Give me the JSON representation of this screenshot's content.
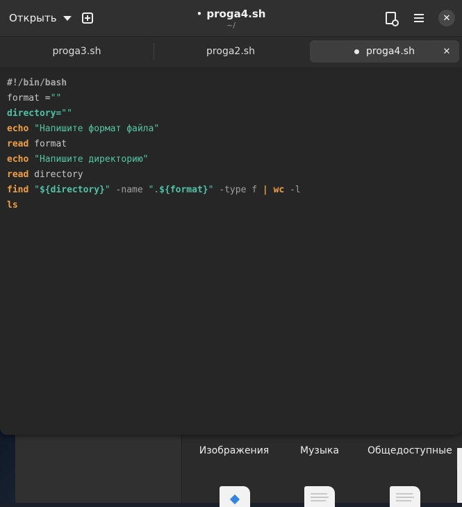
{
  "editor": {
    "header": {
      "open_label": "Открыть",
      "title": "proga4.sh",
      "modified_marker": "•",
      "subtitle": "~/",
      "close_glyph": "✕"
    },
    "tabs": [
      {
        "label": "proga3.sh",
        "active": false,
        "modified": false
      },
      {
        "label": "proga2.sh",
        "active": false,
        "modified": false
      },
      {
        "label": "proga4.sh",
        "active": true,
        "modified": true
      }
    ],
    "tab_close_glyph": "✕",
    "code_lines": [
      [
        {
          "t": "#!/bin/bash",
          "c": "shebang"
        }
      ],
      [
        {
          "t": "format =",
          "c": "plain"
        },
        {
          "t": "\"\"",
          "c": "str"
        }
      ],
      [
        {
          "t": "directory=",
          "c": "var"
        },
        {
          "t": "\"\"",
          "c": "str"
        }
      ],
      [
        {
          "t": "echo",
          "c": "kw"
        },
        {
          "t": " ",
          "c": "plain"
        },
        {
          "t": "\"Напишите формат файла\"",
          "c": "str"
        }
      ],
      [
        {
          "t": "read",
          "c": "kw"
        },
        {
          "t": " format",
          "c": "plain"
        }
      ],
      [
        {
          "t": "echo",
          "c": "kw"
        },
        {
          "t": " ",
          "c": "plain"
        },
        {
          "t": "\"Напишите директорию\"",
          "c": "str"
        }
      ],
      [
        {
          "t": "read",
          "c": "kw"
        },
        {
          "t": " directory",
          "c": "plain"
        }
      ],
      [
        {
          "t": "find",
          "c": "kw"
        },
        {
          "t": " ",
          "c": "plain"
        },
        {
          "t": "\"",
          "c": "str"
        },
        {
          "t": "${directory}",
          "c": "var"
        },
        {
          "t": "\"",
          "c": "str"
        },
        {
          "t": " -name ",
          "c": "op"
        },
        {
          "t": "\".",
          "c": "str"
        },
        {
          "t": "${format}",
          "c": "var"
        },
        {
          "t": "\"",
          "c": "str"
        },
        {
          "t": " -type f ",
          "c": "op"
        },
        {
          "t": "|",
          "c": "kw"
        },
        {
          "t": " ",
          "c": "plain"
        },
        {
          "t": "wc",
          "c": "kw"
        },
        {
          "t": " -l",
          "c": "op"
        }
      ],
      [
        {
          "t": "ls",
          "c": "kw"
        }
      ]
    ]
  },
  "file_manager": {
    "items": [
      {
        "label": "Изображения",
        "icon": "folder-icon"
      },
      {
        "label": "Музыка",
        "icon": "folder-icon"
      },
      {
        "label": "Общедоступные",
        "icon": "folder-icon"
      }
    ]
  },
  "colors": {
    "keyword": "#f0a040",
    "string": "#52c7a2",
    "variable": "#4fc2a4",
    "editor_bg": "#262626"
  }
}
